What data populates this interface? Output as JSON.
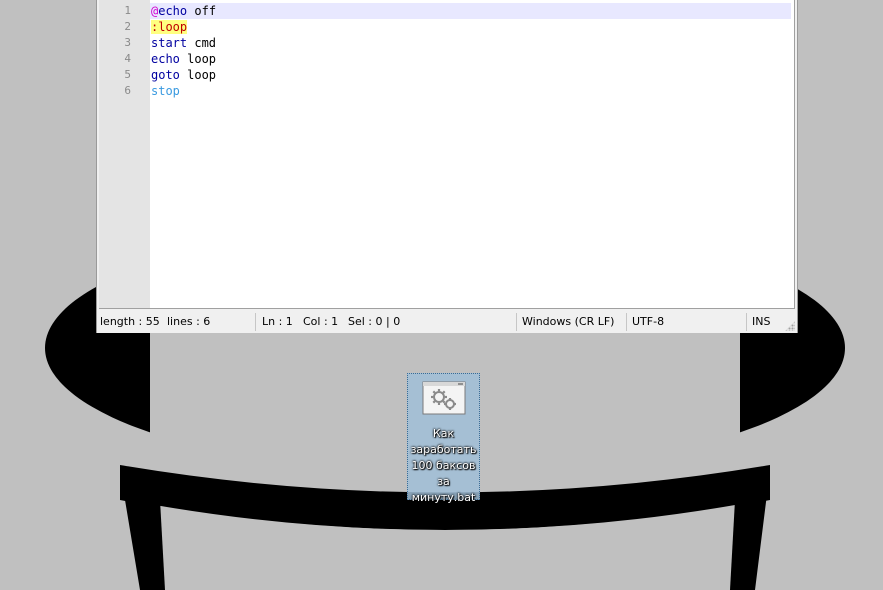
{
  "editor": {
    "line_numbers": [
      "1",
      "2",
      "3",
      "4",
      "5",
      "6"
    ],
    "lines": [
      [
        {
          "t": "@",
          "c": "at"
        },
        {
          "t": "echo",
          "c": "kw"
        },
        {
          "t": " off",
          "c": ""
        }
      ],
      [
        {
          "t": ":loop",
          "c": "lbl"
        }
      ],
      [
        {
          "t": "start",
          "c": "kw"
        },
        {
          "t": " cmd",
          "c": ""
        }
      ],
      [
        {
          "t": "echo",
          "c": "kw"
        },
        {
          "t": " loop",
          "c": ""
        }
      ],
      [
        {
          "t": "goto",
          "c": "kw"
        },
        {
          "t": " loop",
          "c": ""
        }
      ],
      [
        {
          "t": "stop",
          "c": "err"
        }
      ]
    ]
  },
  "status_bar": {
    "length": "length : 55",
    "lines": "lines : 6",
    "ln": "Ln : 1",
    "col": "Col : 1",
    "sel": "Sel : 0 | 0",
    "eol": "Windows (CR LF)",
    "encoding": "UTF-8",
    "mode": "INS"
  },
  "desktop_file": {
    "label": "Как заработать 100 баксов за минуту.bat",
    "icon": "batch-file-gears-icon"
  },
  "colors": {
    "desktop_bg": "#c0c0c0",
    "keyword": "#0000a0",
    "label_bg": "#ffff80",
    "selection": "#a0bed7"
  }
}
